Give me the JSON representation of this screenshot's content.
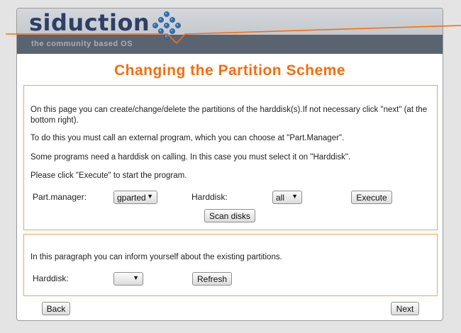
{
  "header": {
    "logo_text": "siduction",
    "tagline": "the community based OS"
  },
  "page": {
    "title": "Changing the Partition Scheme"
  },
  "panel1": {
    "para1": "On this page you can create/change/delete the partitions of the harddisk(s).If not necessary click \"next\" (at the bottom right).",
    "para2": "To do this you must call an external program, which you can choose at \"Part.Manager\".",
    "para3": "Some programs need a harddisk on calling. In this case you must select it on \"Harddisk\".",
    "para4": "Please click \"Execute\" to start the program.",
    "part_manager_label": "Part.manager:",
    "part_manager_value": "gparted",
    "harddisk_label": "Harddisk:",
    "harddisk_value": "all",
    "execute_label": "Execute",
    "scan_label": "Scan disks"
  },
  "panel2": {
    "para1": "In this paragraph you can inform yourself about the existing partitions.",
    "harddisk_label": "Harddisk:",
    "harddisk_value": "",
    "refresh_label": "Refresh"
  },
  "footer": {
    "back_label": "Back",
    "next_label": "Next"
  },
  "colors": {
    "accent": "#ff6a0a",
    "panel_border": "#f5a05a",
    "header_dark": "#5a6470",
    "logo": "#2e3f66"
  },
  "icons": [
    "siduction-logo-dots-icon",
    "chevron-down-icon"
  ]
}
